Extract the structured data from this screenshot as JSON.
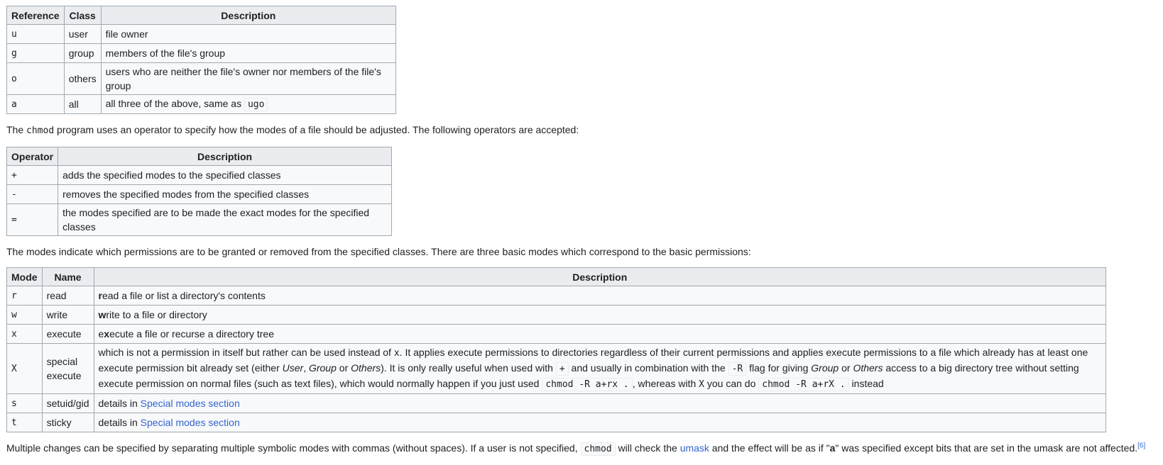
{
  "table_refs": {
    "headers": [
      "Reference",
      "Class",
      "Description"
    ],
    "rows": [
      {
        "ref": "u",
        "cls": "user",
        "desc": "file owner"
      },
      {
        "ref": "g",
        "cls": "group",
        "desc": "members of the file's group"
      },
      {
        "ref": "o",
        "cls": "others",
        "desc": "users who are neither the file's owner nor members of the file's group"
      },
      {
        "ref": "a",
        "cls": "all",
        "desc_prefix": "all three of the above, same as ",
        "desc_code": "ugo"
      }
    ]
  },
  "para1": {
    "pre": "The ",
    "code": "chmod",
    "post": " program uses an operator to specify how the modes of a file should be adjusted. The following operators are accepted:"
  },
  "table_ops": {
    "headers": [
      "Operator",
      "Description"
    ],
    "rows": [
      {
        "op": "+",
        "desc": "adds the specified modes to the specified classes"
      },
      {
        "op": "-",
        "desc": "removes the specified modes from the specified classes"
      },
      {
        "op": "=",
        "desc": "the modes specified are to be made the exact modes for the specified classes"
      }
    ]
  },
  "para2": "The modes indicate which permissions are to be granted or removed from the specified classes. There are three basic modes which correspond to the basic permissions:",
  "table_modes": {
    "headers": [
      "Mode",
      "Name",
      "Description"
    ],
    "rows": [
      {
        "mode": "r",
        "name": "read",
        "bold": "r",
        "rest": "ead a file or list a directory's contents"
      },
      {
        "mode": "w",
        "name": "write",
        "bold": "w",
        "rest": "rite to a file or directory"
      },
      {
        "mode": "x",
        "name": "execute",
        "pre": "e",
        "bold": "x",
        "rest": "ecute a file or recurse a directory tree"
      },
      {
        "mode": "X",
        "name_line1": "special",
        "name_line2": "execute",
        "d1": "which is not a permission in itself but rather can be used instead of ",
        "d1_code": "x",
        "d2": ". It applies execute permissions to directories regardless of their current permissions and applies execute permissions to a file which already has at least one execute permission bit already set (either ",
        "i_user": "User",
        "c1": ", ",
        "i_group": "Group",
        "or1": " or ",
        "i_others": "Others",
        "d3": "). It is only really useful when used with ",
        "code_plus": "+",
        "d4": " and usually in combination with the ",
        "code_r": "-R",
        "d5": " flag for giving ",
        "i_group2": "Group",
        "or2": " or ",
        "i_others2": "Others",
        "d6": " access to a big directory tree without setting execute permission on normal files (such as text files), which would normally happen if you just used ",
        "code_cmd1": "chmod -R a+rx .",
        "d7": ", whereas with ",
        "d7_code": "X",
        "d8": " you can do ",
        "code_cmd2": "chmod -R a+rX .",
        "d9": " instead"
      },
      {
        "mode": "s",
        "name": "setuid/gid",
        "pre": "details in ",
        "link": "Special modes section"
      },
      {
        "mode": "t",
        "name": "sticky",
        "pre": "details in ",
        "link": "Special modes section"
      }
    ]
  },
  "para3": {
    "p1": "Multiple changes can be specified by separating multiple symbolic modes with commas (without spaces). If a user is not specified, ",
    "code": "chmod",
    "p2": " will check the ",
    "link": "umask",
    "p3": " and the effect will be as if \"",
    "bold": "a",
    "p4": "\" was specified except bits that are set in the umask are not affected.",
    "ref": "[6]"
  },
  "colors": {
    "link": "#3366cc",
    "header_bg": "#eaecf0",
    "cell_bg": "#f8f9fa",
    "border": "#a2a9b1"
  }
}
